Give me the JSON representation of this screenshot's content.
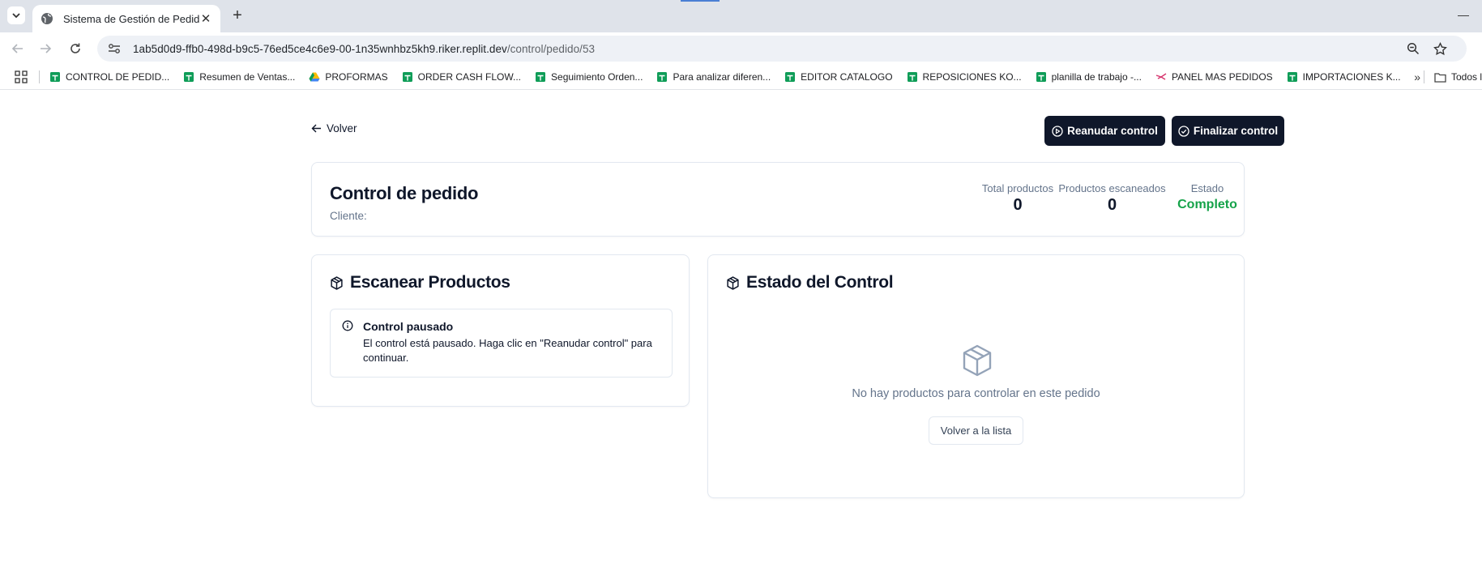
{
  "browser": {
    "tab_title": "Sistema de Gestión de Pedidos",
    "tab_close": "✕",
    "new_tab": "+",
    "url_host": "1ab5d0d9-ffb0-498d-b9c5-76ed5ce4c6e9-00-1n35wnhbz5kh9.riker.replit.dev",
    "url_path": "/control/pedido/53",
    "bookmarks": [
      {
        "label": "CONTROL DE PEDID...",
        "icon": "sheets-icon"
      },
      {
        "label": "Resumen de Ventas...",
        "icon": "sheets-icon"
      },
      {
        "label": "PROFORMAS",
        "icon": "drive-icon"
      },
      {
        "label": "ORDER CASH FLOW...",
        "icon": "sheets-icon"
      },
      {
        "label": "Seguimiento Orden...",
        "icon": "sheets-icon"
      },
      {
        "label": "Para analizar diferen...",
        "icon": "sheets-icon"
      },
      {
        "label": "EDITOR CATALOGO",
        "icon": "sheets-icon"
      },
      {
        "label": "REPOSICIONES KO...",
        "icon": "sheets-icon"
      },
      {
        "label": "planilla de trabajo -...",
        "icon": "sheets-icon"
      },
      {
        "label": "PANEL MAS PEDIDOS",
        "icon": "brand-icon"
      },
      {
        "label": "IMPORTACIONES K...",
        "icon": "sheets-icon"
      }
    ],
    "bookmarks_more": "»",
    "bookmarks_folder": "Todos l",
    "colors": {
      "sheets": "#0f9d58",
      "accent": "#4a7fd4"
    }
  },
  "page": {
    "back_label": "Volver",
    "resume_label": "Reanudar control",
    "finish_label": "Finalizar control",
    "header": {
      "title": "Control de pedido",
      "client_label": "Cliente:",
      "stats": [
        {
          "label": "Total productos",
          "value": "0"
        },
        {
          "label": "Productos escaneados",
          "value": "0"
        },
        {
          "label": "Estado",
          "value": "Completo"
        }
      ]
    },
    "scan": {
      "title": "Escanear Productos",
      "alert_title": "Control pausado",
      "alert_text": "El control está pausado. Haga clic en \"Reanudar control\" para continuar."
    },
    "status": {
      "title": "Estado del Control",
      "empty_text": "No hay productos para controlar en este pedido",
      "back_to_list": "Volver a la lista"
    },
    "colors": {
      "primary": "#0f172a",
      "success": "#16a34a",
      "muted": "#64748b",
      "border": "#e2e8f0"
    }
  }
}
